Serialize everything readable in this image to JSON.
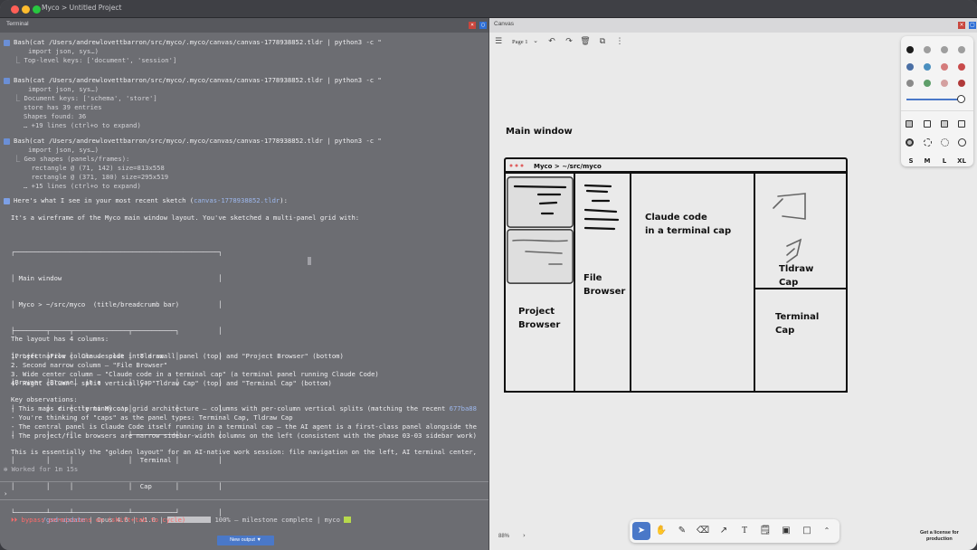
{
  "window": {
    "title": "Myco > Untitled Project"
  },
  "terminal": {
    "panel_title": "Terminal",
    "blocks": [
      {
        "cmd": "Bash(cat /Users/andrewlovettbarron/src/myco/.myco/canvas/canvas-1778938852.tldr | python3 -c \"",
        "cont": "import json, sys…)",
        "out": [
          "Top-level keys: ['document', 'session']"
        ]
      },
      {
        "cmd": "Bash(cat /Users/andrewlovettbarron/src/myco/.myco/canvas/canvas-1778938852.tldr | python3 -c \"",
        "cont": "import json, sys…)",
        "out": [
          "Document keys: ['schema', 'store']",
          "store has 39 entries",
          "Shapes found: 36",
          "… +19 lines (ctrl+o to expand)"
        ]
      },
      {
        "cmd": "Bash(cat /Users/andrewlovettbarron/src/myco/.myco/canvas/canvas-1778938852.tldr | python3 -c \"",
        "cont": "import json, sys…)",
        "out": [
          "Geo shapes (panels/frames):",
          "  rectangle @ (71, 142) size=813x558",
          "  rectangle @ (371, 180) size=295x519",
          "… +15 lines (ctrl+o to expand)"
        ]
      }
    ],
    "summary_prefix": "Here's what I see in your most recent sketch (",
    "summary_link": "canvas-1778938852.tldr",
    "summary_suffix": "):",
    "intro": "It's a wireframe of the Myco main window layout. You've sketched a multi-panel grid with:",
    "ascii_box": [
      "┌────────────────────────────────────────────────────┐",
      "│ Main window                                        │",
      "│ Myco > ~/src/myco  (title/breadcrumb bar)          │",
      "├────────┬─────┬──────────────┬───────────┐          │",
      "│Project │File │  Claude code │  Tldraw   │          │",
      "│Browser │Browse│  in a       │  Cap      │          │",
      "│        │  r  │  terminal cap│           │          │",
      "│        │     │              ├───────────┤          │",
      "│        │     │              │  Terminal │          │",
      "│        │     │              │  Cap      │          │",
      "└────────┴─────┴──────────────┴───────────┘          │"
    ],
    "layout_heading": "The layout has 4 columns:",
    "columns": [
      "1. Left narrow column — split into a small panel (top) and \"Project Browser\" (bottom)",
      "2. Second narrow column — \"File Browser\"",
      "3. Wide center column — \"Claude code in a terminal cap\" (a terminal panel running Claude Code)",
      "4. Right column — split vertically: \"Tldraw Cap\" (top) and \"Terminal Cap\" (bottom)"
    ],
    "obs_heading": "Key observations:",
    "observations": [
      "- This maps directly to Myco's grid architecture — columns with per-column vertical splits (matching the recent ",
      "- You're thinking of \"caps\" as the panel types: Terminal Cap, Tldraw Cap",
      "- The central panel is Claude Code itself running in a terminal cap — the AI agent is a first-class panel alongside the",
      "- The project/file browsers are narrow sidebar-width columns on the left (consistent with the phase 03-03 sidebar work)"
    ],
    "obs_commit": "677ba88",
    "closing": "This is essentially the \"golden layout\" for an AI-native work session: file navigation on the left, AI terminal center,",
    "worked": "✻ Worked for 1m 15s",
    "prompt": "›",
    "status_cmd": "/gsd-update",
    "status_model": "Opus 4.6",
    "status_version": "v1.0",
    "status_progress": 1.0,
    "status_rest": "100% — milestone complete | myco",
    "bypass": "⏵⏵ bypass permissions on (shift+tab to cycle)",
    "new_output": "New output ▼"
  },
  "canvas": {
    "panel_title": "Canvas",
    "page_label": "Page 1",
    "sketch": {
      "main_window_label": "Main window",
      "breadcrumb": "Myco > ~/src/myco",
      "file_browser": "File\nBrowser",
      "claude": "Claude code\nin a terminal cap",
      "project_browser": "Project\nBrowser",
      "tldraw": "Tldraw\nCap",
      "terminal": "Terminal\nCap"
    },
    "colors": [
      "#1d1d1d",
      "#9e9e9e",
      "#9e9e9e",
      "#9e9e9e",
      "#4a6fa5",
      "#4a8fbf",
      "#d47b7b",
      "#c84b4b",
      "#8a8a8a",
      "#5e9e6a",
      "#d4a0a0",
      "#b03a3a"
    ],
    "sizes": [
      "S",
      "M",
      "L",
      "XL"
    ],
    "zoom": "88%",
    "license": "Get a license for\nproduction"
  }
}
